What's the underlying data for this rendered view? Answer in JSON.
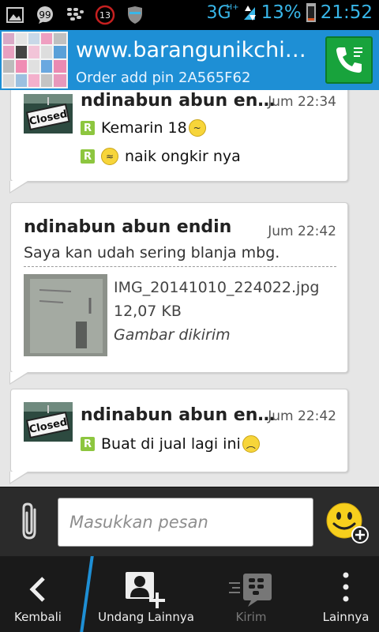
{
  "statusbar": {
    "network": "3G",
    "network_sup": "H+",
    "notif_count": "13",
    "battery": "13%",
    "time": "21:52",
    "accent": "#38b6e8"
  },
  "header": {
    "title": "www.barangunikchin…",
    "subtitle": "Order add pin 2A565F62",
    "bg_color": "#1e8fd5",
    "call_icon": "phone-icon"
  },
  "messages": [
    {
      "sender": "ndinabun abun en…",
      "time": "Jum 22:34",
      "thumb_label": "Closed",
      "lines": [
        {
          "badge": "R",
          "text": "Kemarin 18",
          "emoji": "confused-emoji",
          "emoji_first": false
        },
        {
          "badge": "R",
          "text": "naik ongkir nya",
          "emoji": "worried-emoji",
          "emoji_first": true
        }
      ]
    },
    {
      "sender": "ndinabun abun endin",
      "time": "Jum 22:42",
      "text": "Saya kan udah sering blanja mbg.",
      "attachment": {
        "filename": "IMG_20141010_224022.jpg",
        "size": "12,07 KB",
        "status": "Gambar dikirim"
      }
    },
    {
      "sender": "ndinabun abun en…",
      "time": "Jum 22:42",
      "thumb_label": "Closed",
      "lines": [
        {
          "badge": "R",
          "text": "Buat di jual lagi ini",
          "emoji": "sad-emoji",
          "emoji_first": false
        }
      ]
    }
  ],
  "compose": {
    "placeholder": "Masukkan pesan",
    "attach_icon": "paperclip-icon",
    "emoji_icon": "smiley-add-icon"
  },
  "bottombar": {
    "back_label": "Kembali",
    "invite_label": "Undang Lainnya",
    "send_label": "Kirim",
    "more_label": "Lainnya"
  }
}
